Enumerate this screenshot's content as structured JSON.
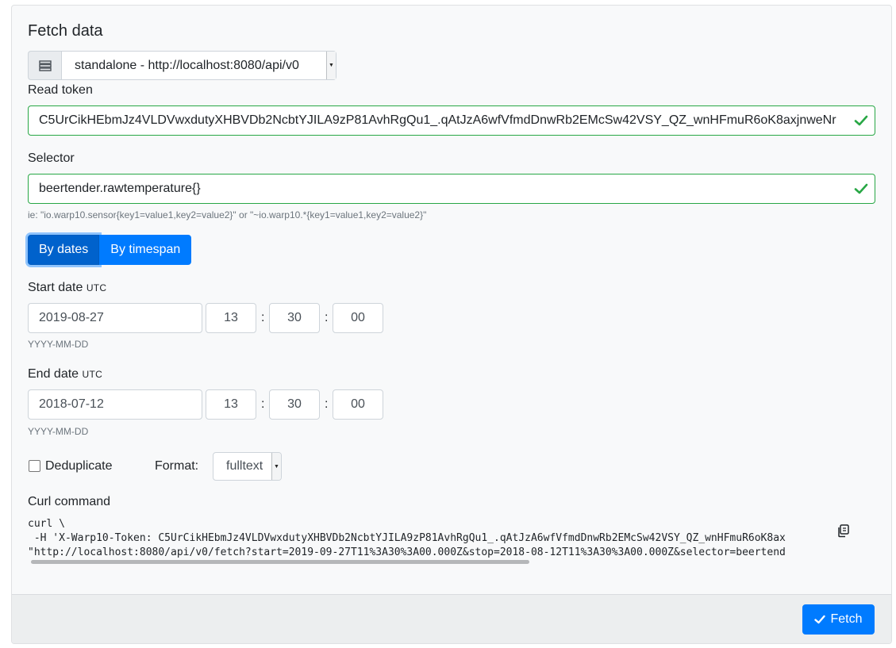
{
  "panel": {
    "title": "Fetch data"
  },
  "source": {
    "selected": "standalone - http://localhost:8080/api/v0",
    "icon": "server-icon"
  },
  "read_token": {
    "label": "Read token",
    "value": "C5UrCikHEbmJz4VLDVwxdutyXHBVDb2NcbtYJILA9zP81AvhRgQu1_.qAtJzA6wfVfmdDnwRb2EMcSw42VSY_QZ_wnHFmuR6oK8axjnweNr",
    "valid": true
  },
  "selector": {
    "label": "Selector",
    "value": "beertender.rawtemperature{}",
    "valid": true,
    "hint": "ie: \"io.warp10.sensor{key1=value1,key2=value2}\" or \"~io.warp10.*{key1=value1,key2=value2}\""
  },
  "mode": {
    "by_dates": "By dates",
    "by_timespan": "By timespan",
    "active": "by_dates"
  },
  "start": {
    "label": "Start date",
    "tz": "UTC",
    "date": "2019-08-27",
    "hour": "13",
    "minute": "30",
    "second": "00",
    "format_hint": "YYYY-MM-DD"
  },
  "end": {
    "label": "End date",
    "tz": "UTC",
    "date": "2018-07-12",
    "hour": "13",
    "minute": "30",
    "second": "00",
    "format_hint": "YYYY-MM-DD"
  },
  "sep": ":",
  "options": {
    "dedup_label": "Deduplicate",
    "dedup_checked": false,
    "format_label": "Format:",
    "format_value": "fulltext"
  },
  "curl": {
    "label": "Curl command",
    "line1": "curl \\",
    "line2": " -H 'X-Warp10-Token: C5UrCikHEbmJz4VLDVwxdutyXHBVDb2NcbtYJILA9zP81AvhRgQu1_.qAtJzA6wfVfmdDnwRb2EMcSw42VSY_QZ_wnHFmuR6oK8ax",
    "line3": "\"http://localhost:8080/api/v0/fetch?start=2019-09-27T11%3A30%3A00.000Z&stop=2018-08-12T11%3A30%3A00.000Z&selector=beertend"
  },
  "footer": {
    "fetch_label": "Fetch"
  },
  "colors": {
    "primary": "#007bff",
    "primary_active": "#0062cc",
    "valid": "#28a745"
  }
}
